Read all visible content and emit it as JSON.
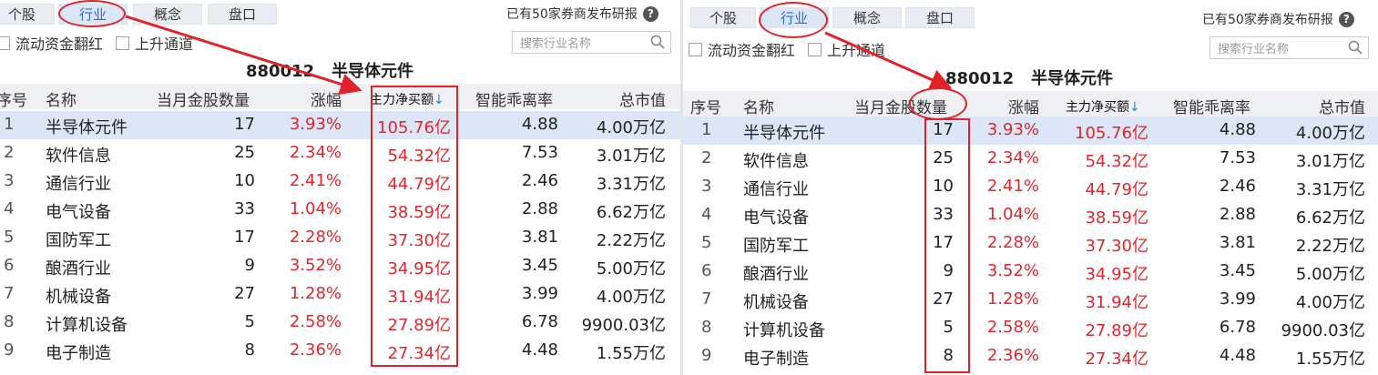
{
  "tabs": [
    "个股",
    "行业",
    "概念",
    "盘口"
  ],
  "active_tab": "行业",
  "reports_notice": "已有50家券商发布研报",
  "help_icon": "question-circle-icon",
  "filters": [
    "流动资金翻红",
    "上升通道"
  ],
  "search_placeholder": "搜索行业名称",
  "search_icon": "search-icon",
  "sector": {
    "code": "880012",
    "name": "半导体元件"
  },
  "columns": [
    "序号",
    "名称",
    "当月金股数量",
    "涨幅",
    "主力净买额",
    "智能乖离率",
    "总市值"
  ],
  "sort_arrow": "↓",
  "rows": [
    {
      "no": "1",
      "name": "半导体元件",
      "count": "17",
      "change": "3.93%",
      "net": "105.76亿",
      "bias": "4.88",
      "cap": "4.00万亿"
    },
    {
      "no": "2",
      "name": "软件信息",
      "count": "25",
      "change": "2.34%",
      "net": "54.32亿",
      "bias": "7.53",
      "cap": "3.01万亿"
    },
    {
      "no": "3",
      "name": "通信行业",
      "count": "10",
      "change": "2.41%",
      "net": "44.79亿",
      "bias": "2.46",
      "cap": "3.31万亿"
    },
    {
      "no": "4",
      "name": "电气设备",
      "count": "33",
      "change": "1.04%",
      "net": "38.59亿",
      "bias": "2.88",
      "cap": "6.62万亿"
    },
    {
      "no": "5",
      "name": "国防军工",
      "count": "17",
      "change": "2.28%",
      "net": "37.30亿",
      "bias": "3.81",
      "cap": "2.22万亿"
    },
    {
      "no": "6",
      "name": "酿酒行业",
      "count": "9",
      "change": "3.52%",
      "net": "34.95亿",
      "bias": "3.45",
      "cap": "5.00万亿"
    },
    {
      "no": "7",
      "name": "机械设备",
      "count": "27",
      "change": "1.28%",
      "net": "31.94亿",
      "bias": "3.99",
      "cap": "4.00万亿"
    },
    {
      "no": "8",
      "name": "计算机设备",
      "count": "5",
      "change": "2.58%",
      "net": "27.89亿",
      "bias": "6.78",
      "cap": "9900.03亿"
    },
    {
      "no": "9",
      "name": "电子制造",
      "count": "8",
      "change": "2.36%",
      "net": "27.34亿",
      "bias": "4.48",
      "cap": "1.55万亿"
    }
  ],
  "colors": {
    "up_red": "#e0272e",
    "annotation_red": "#e0232a",
    "selected_row": "#dde6f7",
    "tab_active_text": "#2a6fd1"
  }
}
